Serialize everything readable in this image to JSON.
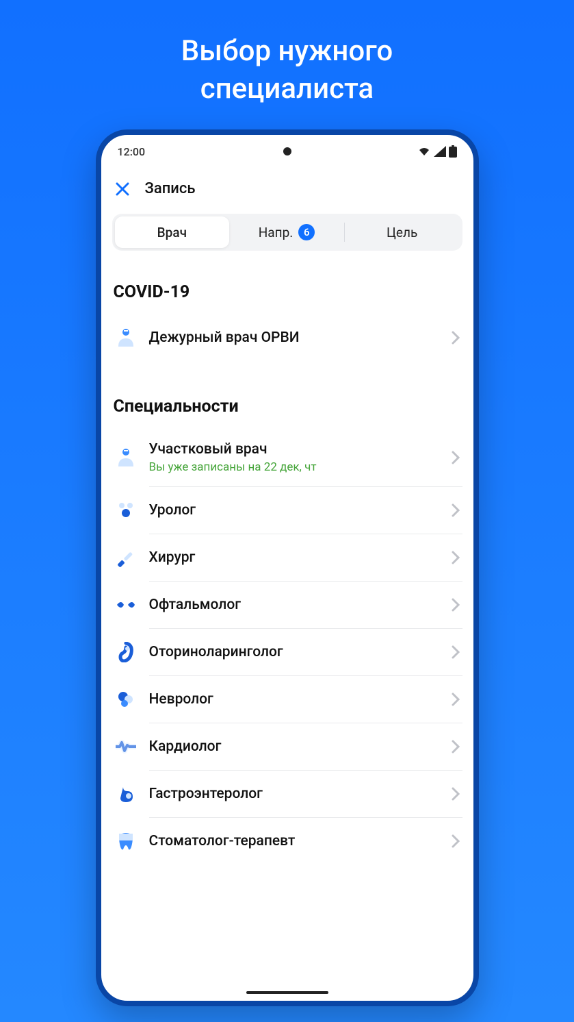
{
  "promo": {
    "title_line1": "Выбор нужного",
    "title_line2": "специалиста"
  },
  "status": {
    "time": "12:00"
  },
  "header": {
    "title": "Запись"
  },
  "tabs": {
    "doctor": "Врач",
    "referral": "Напр.",
    "referral_count": "6",
    "goal": "Цель"
  },
  "sections": {
    "covid": {
      "title": "COVID-19",
      "items": [
        {
          "icon": "doctor",
          "title": "Дежурный врач ОРВИ"
        }
      ]
    },
    "specialties": {
      "title": "Специальности",
      "items": [
        {
          "icon": "doctor",
          "title": "Участковый врач",
          "sub": "Вы уже записаны на 22 дек, чт"
        },
        {
          "icon": "urology",
          "title": "Уролог"
        },
        {
          "icon": "scalpel",
          "title": "Хирург"
        },
        {
          "icon": "eye",
          "title": "Офтальмолог"
        },
        {
          "icon": "ear",
          "title": "Оториноларинголог"
        },
        {
          "icon": "neuro",
          "title": "Невролог"
        },
        {
          "icon": "cardio",
          "title": "Кардиолог"
        },
        {
          "icon": "gastro",
          "title": "Гастроэнтеролог"
        },
        {
          "icon": "tooth",
          "title": "Стоматолог-терапевт"
        }
      ]
    }
  }
}
